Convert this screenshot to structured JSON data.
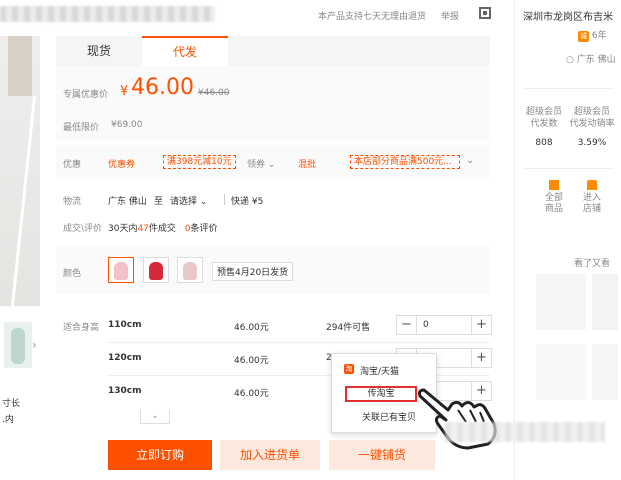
{
  "header": {
    "notice": "本产品支持七天无理由退货",
    "report": "举报"
  },
  "tabs": [
    {
      "label": "现货"
    },
    {
      "label": "代发"
    }
  ],
  "price": {
    "label": "专属优惠价",
    "currency": "¥",
    "value": "46.00",
    "original": "¥46.00",
    "min_label": "最低限价",
    "min_value": "¥69.00"
  },
  "promo": {
    "label": "优惠",
    "coupon": "优惠券",
    "coupon_tag": "满398元减10元",
    "get_coupon": "领券",
    "mix": "混批",
    "mix_tag": "本店部分商品满500元..."
  },
  "shipping": {
    "label": "物流",
    "from": "广东 佛山",
    "to_label": "至",
    "to_select": "请选择",
    "express": "快递 ¥5"
  },
  "deals": {
    "label": "成交\\评价",
    "prefix": "30天内",
    "count": "47",
    "suffix": "件成交",
    "review_count": "0",
    "review_suffix": "条评价"
  },
  "color": {
    "label": "颜色",
    "presale": "预售4月20日发货"
  },
  "sizes": {
    "label": "适合身高",
    "rows": [
      {
        "size": "110cm",
        "price": "46.00元",
        "stock": "294件可售",
        "qty": "0"
      },
      {
        "size": "120cm",
        "price": "46.00元",
        "stock": "2",
        "qty": "0"
      },
      {
        "size": "130cm",
        "price": "46.00元",
        "stock": "",
        "qty": "0"
      }
    ]
  },
  "popup": {
    "title": "淘宝/天猫",
    "option1": "传淘宝",
    "option2": "关联已有宝贝"
  },
  "actions": {
    "buy": "立即订购",
    "add": "加入进货单",
    "dropship": "一键铺货"
  },
  "left_panel": {
    "text1": "寸长",
    "text2": ".内"
  },
  "right_panel": {
    "shop_name": "深圳市龙岗区布吉米",
    "years": "6年",
    "location": "广东 佛山",
    "stat1_label": "超级会员\n代发数",
    "stat1_value": "808",
    "stat2_label": "超级会员\n代发动销率",
    "stat2_value": "3.59%",
    "all_goods": "全部\n商品",
    "enter_shop": "进入\n店铺",
    "see_more": "看了又看"
  },
  "colors": {
    "accent": "#ff5000",
    "tab_bg": "#f5f5f5",
    "button_light": "#fde8de"
  }
}
